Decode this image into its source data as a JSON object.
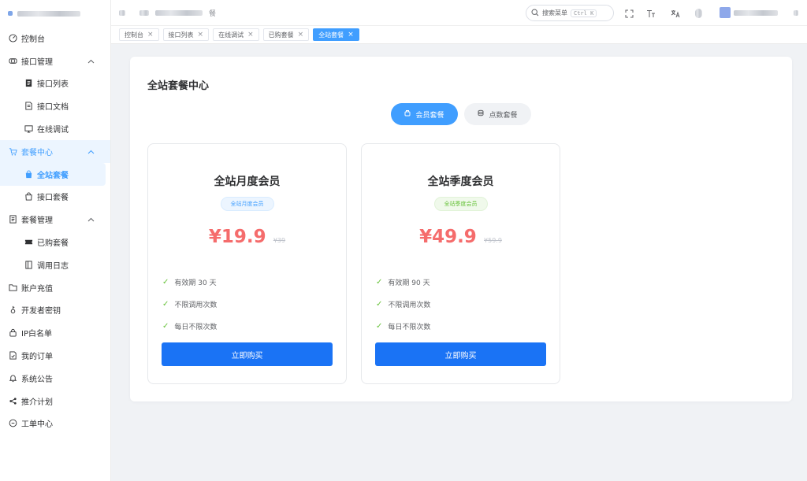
{
  "header": {
    "breadcrumb_current": "餐",
    "search_label": "搜索菜单",
    "search_shortcut": "Ctrl K"
  },
  "sidebar": {
    "items": [
      {
        "label": "控制台"
      },
      {
        "label": "接口管理"
      },
      {
        "label": "接口列表"
      },
      {
        "label": "接口文档"
      },
      {
        "label": "在线调试"
      },
      {
        "label": "套餐中心"
      },
      {
        "label": "全站套餐"
      },
      {
        "label": "接口套餐"
      },
      {
        "label": "套餐管理"
      },
      {
        "label": "已购套餐"
      },
      {
        "label": "调用日志"
      },
      {
        "label": "账户充值"
      },
      {
        "label": "开发者密钥"
      },
      {
        "label": "IP白名单"
      },
      {
        "label": "我的订单"
      },
      {
        "label": "系统公告"
      },
      {
        "label": "推介计划"
      },
      {
        "label": "工单中心"
      }
    ]
  },
  "tabs": [
    {
      "label": "控制台"
    },
    {
      "label": "接口列表"
    },
    {
      "label": "在线调试"
    },
    {
      "label": "已购套餐"
    },
    {
      "label": "全站套餐"
    }
  ],
  "main": {
    "title": "全站套餐中心",
    "switch_member": "会员套餐",
    "switch_points": "点数套餐",
    "plans": [
      {
        "name": "全站月度会员",
        "tag": "全站月度会员",
        "price": "¥19.9",
        "old_price": "¥39",
        "features": [
          "有效期 30 天",
          "不限调用次数",
          "每日不限次数"
        ],
        "button": "立即购买"
      },
      {
        "name": "全站季度会员",
        "tag": "全站季度会员",
        "price": "¥49.9",
        "old_price": "¥59.9",
        "features": [
          "有效期 90 天",
          "不限调用次数",
          "每日不限次数"
        ],
        "button": "立即购买"
      }
    ]
  },
  "colors": {
    "primary": "#409eff",
    "buy_button": "#1a73f5",
    "price": "#f56c6c",
    "check": "#67c23a"
  }
}
